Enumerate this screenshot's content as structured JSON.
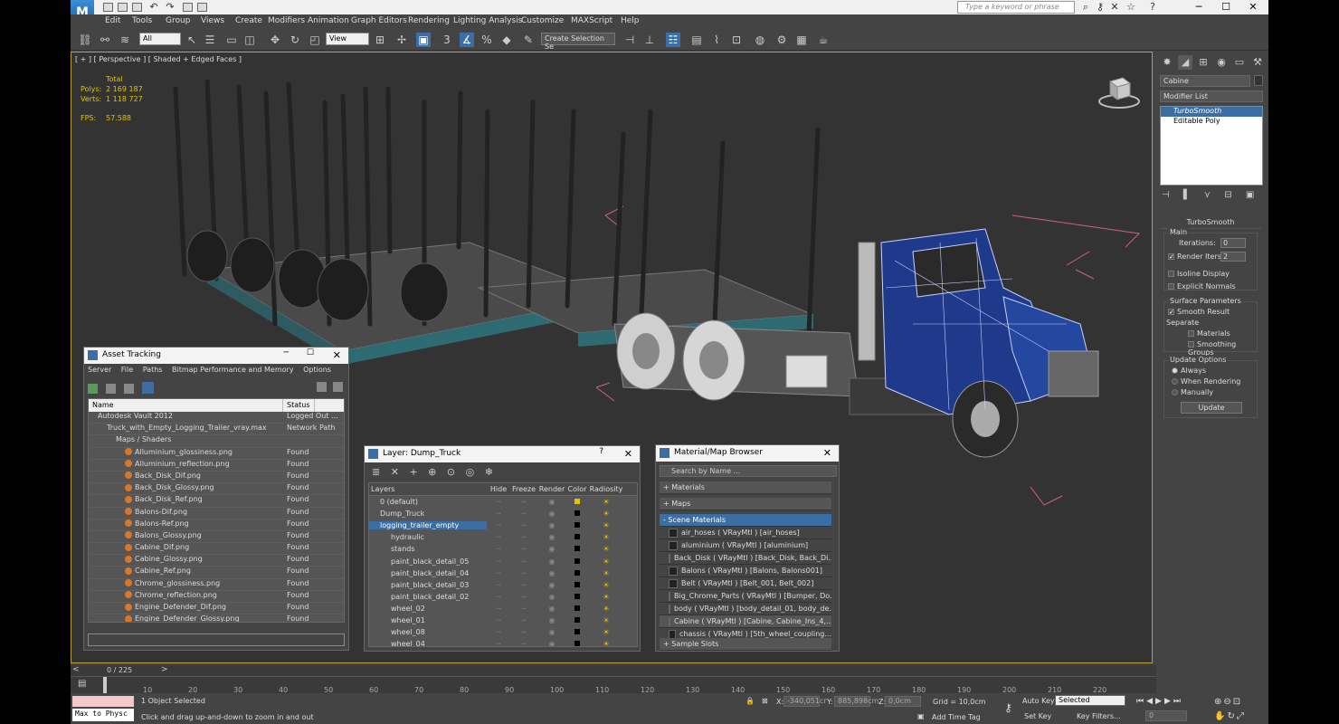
{
  "menu": [
    "Edit",
    "Tools",
    "Group",
    "Views",
    "Create",
    "Modifiers",
    "Animation",
    "Graph Editors",
    "Rendering",
    "Lighting Analysis",
    "Customize",
    "MAXScript",
    "Help"
  ],
  "search_placeholder": "Type a keyword or phrase",
  "toolbar": {
    "selection_filter": "All",
    "ref_coord": "View",
    "named_selection": "Create Selection Se"
  },
  "viewport": {
    "label": "[ + ] [ Perspective ] [ Shaded + Edged Faces ]",
    "stats_header": "Total",
    "polys_label": "Polys:",
    "polys": "2 169 187",
    "verts_label": "Verts:",
    "verts": "1 118 727",
    "fps_label": "FPS:",
    "fps": "57.588"
  },
  "command_panel": {
    "object_name": "Cabine",
    "modifier_list": "Modifier List",
    "stack": [
      "TurboSmooth",
      "Editable Poly"
    ],
    "rollout_title": "TurboSmooth",
    "main_label": "Main",
    "iterations_label": "Iterations:",
    "iterations": "0",
    "render_iters_label": "Render Iters:",
    "render_iters": "2",
    "isoline": "Isoline Display",
    "explicit_normals": "Explicit Normals",
    "surface_params": "Surface Parameters",
    "smooth_result": "Smooth Result",
    "separate": "Separate",
    "materials": "Materials",
    "smoothing_groups": "Smoothing Groups",
    "update_options": "Update Options",
    "always": "Always",
    "when_rendering": "When Rendering",
    "manually": "Manually",
    "update_btn": "Update"
  },
  "asset_tracking": {
    "title": "Asset Tracking",
    "menu": [
      "Server",
      "File",
      "Paths",
      "Bitmap Performance and Memory",
      "Options"
    ],
    "col_name": "Name",
    "col_status": "Status",
    "rows": [
      {
        "name": "Autodesk Vault 2012",
        "status": "Logged Out ...",
        "indent": 1
      },
      {
        "name": "Truck_with_Empty_Logging_Trailer_vray.max",
        "status": "Network Path",
        "indent": 2
      },
      {
        "name": "Maps / Shaders",
        "status": "",
        "indent": 3
      },
      {
        "name": "Alluminium_glossiness.png",
        "status": "Found",
        "indent": 4
      },
      {
        "name": "Alluminium_reflection.png",
        "status": "Found",
        "indent": 4
      },
      {
        "name": "Back_Disk_Dif.png",
        "status": "Found",
        "indent": 4
      },
      {
        "name": "Back_Disk_Glossy.png",
        "status": "Found",
        "indent": 4
      },
      {
        "name": "Back_Disk_Ref.png",
        "status": "Found",
        "indent": 4
      },
      {
        "name": "Balons-Dif.png",
        "status": "Found",
        "indent": 4
      },
      {
        "name": "Balons-Ref.png",
        "status": "Found",
        "indent": 4
      },
      {
        "name": "Balons_Glossy.png",
        "status": "Found",
        "indent": 4
      },
      {
        "name": "Cabine_Dif.png",
        "status": "Found",
        "indent": 4
      },
      {
        "name": "Cabine_Glossy.png",
        "status": "Found",
        "indent": 4
      },
      {
        "name": "Cabine_Ref.png",
        "status": "Found",
        "indent": 4
      },
      {
        "name": "Chrome_glossiness.png",
        "status": "Found",
        "indent": 4
      },
      {
        "name": "Chrome_reflection.png",
        "status": "Found",
        "indent": 4
      },
      {
        "name": "Engine_Defender_Dif.png",
        "status": "Found",
        "indent": 4
      },
      {
        "name": "Engine_Defender_Glossy.png",
        "status": "Found",
        "indent": 4
      }
    ]
  },
  "layer_dialog": {
    "title": "Layer: Dump_Truck",
    "cols": [
      "Layers",
      "Hide",
      "Freeze",
      "Render",
      "Color",
      "Radiosity"
    ],
    "rows": [
      {
        "name": "0 (default)",
        "indent": 1,
        "sel": false
      },
      {
        "name": "Dump_Truck",
        "indent": 1,
        "sel": false
      },
      {
        "name": "logging_trailer_empty",
        "indent": 1,
        "sel": true
      },
      {
        "name": "hydraulic",
        "indent": 2,
        "sel": false
      },
      {
        "name": "stands",
        "indent": 2,
        "sel": false
      },
      {
        "name": "paint_black_detail_05",
        "indent": 2,
        "sel": false
      },
      {
        "name": "paint_black_detail_04",
        "indent": 2,
        "sel": false
      },
      {
        "name": "paint_black_detail_03",
        "indent": 2,
        "sel": false
      },
      {
        "name": "paint_black_detail_02",
        "indent": 2,
        "sel": false
      },
      {
        "name": "wheel_02",
        "indent": 2,
        "sel": false
      },
      {
        "name": "wheel_01",
        "indent": 2,
        "sel": false
      },
      {
        "name": "wheel_08",
        "indent": 2,
        "sel": false
      },
      {
        "name": "wheel_04",
        "indent": 2,
        "sel": false
      }
    ]
  },
  "material_browser": {
    "title": "Material/Map Browser",
    "search_placeholder": "Search by Name ...",
    "sections": [
      "+ Materials",
      "+ Maps",
      "- Scene Materials"
    ],
    "items": [
      "air_hoses ( VRayMtl ) [air_hoses]",
      "aluminium ( VRayMtl ) [aluminium]",
      "Back_Disk ( VRayMtl ) [Back_Disk, Back_Di...",
      "Balons ( VRayMtl ) [Balons, Balons001]",
      "Belt ( VRayMtl ) [Belt_001, Belt_002]",
      "Big_Chrome_Parts ( VRayMtl ) [Bumper, Do...",
      "body ( VRayMtl ) [body_detail_01, body_de...",
      "Cabine ( VRayMtl ) [Cabine, Cabine_Ins_4,...",
      "chassis ( VRayMtl ) [5th_wheel_coupling..."
    ],
    "footer": "+ Sample Slots"
  },
  "timeline": {
    "frame": "0 / 225",
    "ticks": [
      "10",
      "20",
      "30",
      "40",
      "50",
      "60",
      "70",
      "80",
      "90",
      "100",
      "110",
      "120",
      "130",
      "140",
      "150",
      "160",
      "170",
      "180",
      "190",
      "200",
      "210",
      "220"
    ]
  },
  "status": {
    "selected": "1 Object Selected",
    "prompt": "Click and drag up-and-down to zoom in and out",
    "maxscript": "Max to Physc",
    "x_label": "X:",
    "x": "-340,051cr",
    "y_label": "Y:",
    "y": "885,898cm",
    "z_label": "Z:",
    "z": "0,0cm",
    "grid": "Grid = 10,0cm",
    "auto_key": "Auto Key",
    "key_mode": "Selected",
    "set_key": "Set Key",
    "key_filters": "Key Filters...",
    "add_time_tag": "Add Time Tag",
    "frame_field": "0"
  }
}
